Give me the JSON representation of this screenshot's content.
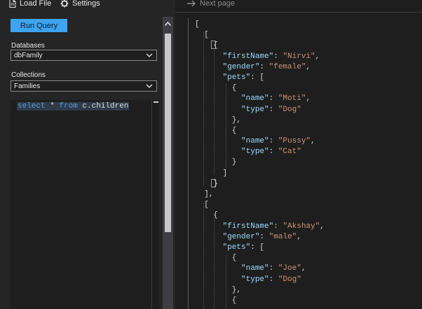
{
  "toolbar": {
    "load_file": "Load File",
    "settings": "Settings",
    "next_page": "Next page"
  },
  "query_panel": {
    "run_query_label": "Run Query",
    "databases_label": "Databases",
    "databases_value": "dbFamily",
    "collections_label": "Collections",
    "collections_value": "Families",
    "query_text": {
      "kw1": "select",
      "mid": " * ",
      "kw2": "from",
      "rest": " c.children"
    }
  },
  "results": {
    "lines": [
      [
        "[",
        "",
        "",
        "",
        ""
      ],
      [
        "  [",
        "",
        "",
        "",
        ""
      ],
      [
        "    {",
        "",
        "",
        "",
        ""
      ],
      [
        "      ",
        "\"firstName\"",
        ": ",
        "\"Nirvi\"",
        ","
      ],
      [
        "      ",
        "\"gender\"",
        ": ",
        "\"female\"",
        ","
      ],
      [
        "      ",
        "\"pets\"",
        ": [",
        "",
        ""
      ],
      [
        "        {",
        "",
        "",
        "",
        ""
      ],
      [
        "          ",
        "\"name\"",
        ": ",
        "\"Moti\"",
        ","
      ],
      [
        "          ",
        "\"type\"",
        ": ",
        "\"Dog\"",
        ""
      ],
      [
        "        },",
        "",
        "",
        "",
        ""
      ],
      [
        "        {",
        "",
        "",
        "",
        ""
      ],
      [
        "          ",
        "\"name\"",
        ": ",
        "\"Pussy\"",
        ","
      ],
      [
        "          ",
        "\"type\"",
        ": ",
        "\"Cat\"",
        ""
      ],
      [
        "        }",
        "",
        "",
        "",
        ""
      ],
      [
        "      ]",
        "",
        "",
        "",
        ""
      ],
      [
        "    }",
        "",
        "",
        "",
        ""
      ],
      [
        "  ],",
        "",
        "",
        "",
        ""
      ],
      [
        "  [",
        "",
        "",
        "",
        ""
      ],
      [
        "    {",
        "",
        "",
        "",
        ""
      ],
      [
        "      ",
        "\"firstName\"",
        ": ",
        "\"Akshay\"",
        ","
      ],
      [
        "      ",
        "\"gender\"",
        ": ",
        "\"male\"",
        ","
      ],
      [
        "      ",
        "\"pets\"",
        ": [",
        "",
        ""
      ],
      [
        "        {",
        "",
        "",
        "",
        ""
      ],
      [
        "          ",
        "\"name\"",
        ": ",
        "\"Joe\"",
        ","
      ],
      [
        "          ",
        "\"type\"",
        ": ",
        "\"Dog\"",
        ""
      ],
      [
        "        },",
        "",
        "",
        "",
        ""
      ],
      [
        "        {",
        "",
        "",
        "",
        ""
      ]
    ]
  },
  "icons": {
    "load_file": "document-icon",
    "settings": "gear-icon",
    "next_page": "arrow-right-icon",
    "dropdown": "chevron-down-icon"
  },
  "colors": {
    "accent": "#3ea4f0",
    "json_key": "#9cdcfe",
    "json_string": "#ce9178",
    "sql_keyword": "#569cd6"
  }
}
